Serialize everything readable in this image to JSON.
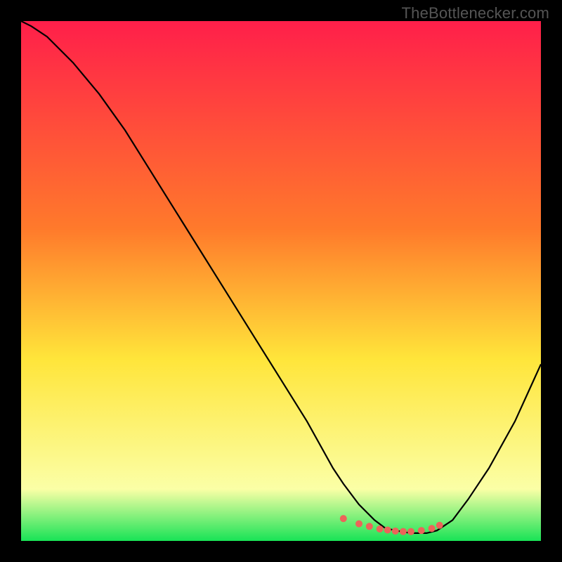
{
  "watermark": "TheBottlenecker.com",
  "colors": {
    "gradient_top": "#ff1f4a",
    "gradient_mid1": "#ff7a2b",
    "gradient_mid2": "#ffe53a",
    "gradient_band": "#fbffa6",
    "gradient_bottom": "#18e356",
    "curve": "#000000",
    "dots": "#ec6459",
    "frame": "#000000"
  },
  "chart_data": {
    "type": "line",
    "title": "",
    "xlabel": "",
    "ylabel": "",
    "xlim": [
      0,
      100
    ],
    "ylim": [
      0,
      100
    ],
    "grid": false,
    "legend": false,
    "series": [
      {
        "name": "bottleneck-curve",
        "x": [
          0,
          2,
          5,
          10,
          15,
          20,
          25,
          30,
          35,
          40,
          45,
          50,
          55,
          60,
          62,
          65,
          68,
          70,
          72,
          75,
          78,
          80,
          83,
          86,
          90,
          95,
          100
        ],
        "y": [
          100,
          99,
          97,
          92,
          86,
          79,
          71,
          63,
          55,
          47,
          39,
          31,
          23,
          14,
          11,
          7,
          4,
          2.5,
          2,
          1.5,
          1.5,
          2,
          4,
          8,
          14,
          23,
          34
        ]
      }
    ],
    "dot_series": {
      "name": "optimal-range-dots",
      "x": [
        62,
        65,
        67,
        69,
        70.5,
        72,
        73.5,
        75,
        77,
        79,
        80.5
      ],
      "y": [
        4.3,
        3.3,
        2.8,
        2.3,
        2.1,
        1.9,
        1.8,
        1.8,
        2.0,
        2.4,
        3.0
      ]
    }
  }
}
